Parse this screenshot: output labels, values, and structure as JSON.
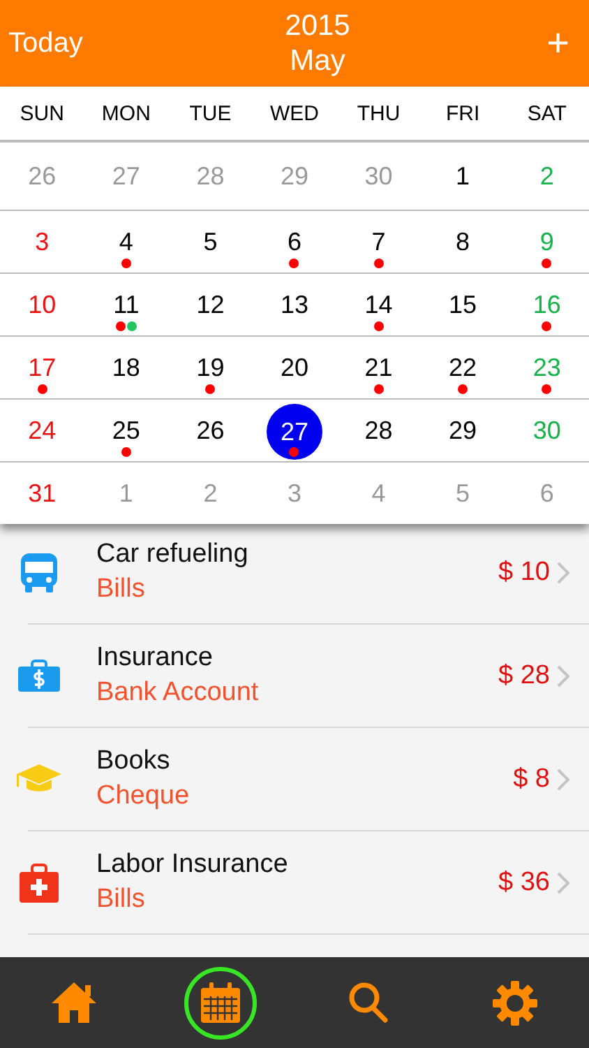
{
  "header": {
    "today_button": "Today",
    "year": "2015",
    "month": "May",
    "add_button": "+"
  },
  "weekdays": [
    "SUN",
    "MON",
    "TUE",
    "WED",
    "THU",
    "FRI",
    "SAT"
  ],
  "weeks": [
    [
      {
        "day": "26",
        "kind": "other",
        "selected": false
      },
      {
        "day": "27",
        "kind": "other",
        "selected": false
      },
      {
        "day": "28",
        "kind": "other",
        "selected": false
      },
      {
        "day": "29",
        "kind": "other",
        "selected": false
      },
      {
        "day": "30",
        "kind": "other",
        "selected": false
      },
      {
        "day": "1",
        "kind": "weekday",
        "selected": false
      },
      {
        "day": "2",
        "kind": "saturday",
        "selected": false
      }
    ],
    [
      {
        "day": "3",
        "kind": "sunday",
        "selected": false
      },
      {
        "day": "4",
        "kind": "weekday",
        "selected": false,
        "dots": [
          {
            "color": "#ff0000"
          }
        ]
      },
      {
        "day": "5",
        "kind": "weekday",
        "selected": false
      },
      {
        "day": "6",
        "kind": "weekday",
        "selected": false,
        "dots": [
          {
            "color": "#ff0000"
          }
        ]
      },
      {
        "day": "7",
        "kind": "weekday",
        "selected": false,
        "dots": [
          {
            "color": "#ff0000"
          }
        ]
      },
      {
        "day": "8",
        "kind": "weekday",
        "selected": false
      },
      {
        "day": "9",
        "kind": "saturday",
        "selected": false,
        "dots": [
          {
            "color": "#ff0000"
          }
        ]
      }
    ],
    [
      {
        "day": "10",
        "kind": "sunday",
        "selected": false
      },
      {
        "day": "11",
        "kind": "weekday",
        "selected": false,
        "dots": [
          {
            "color": "#ff0000"
          },
          {
            "color": "#22c55e"
          }
        ]
      },
      {
        "day": "12",
        "kind": "weekday",
        "selected": false
      },
      {
        "day": "13",
        "kind": "weekday",
        "selected": false
      },
      {
        "day": "14",
        "kind": "weekday",
        "selected": false,
        "dots": [
          {
            "color": "#ff0000"
          }
        ]
      },
      {
        "day": "15",
        "kind": "weekday",
        "selected": false
      },
      {
        "day": "16",
        "kind": "saturday",
        "selected": false,
        "dots": [
          {
            "color": "#ff0000"
          }
        ]
      }
    ],
    [
      {
        "day": "17",
        "kind": "sunday",
        "selected": false,
        "dots": [
          {
            "color": "#ff0000"
          }
        ]
      },
      {
        "day": "18",
        "kind": "weekday",
        "selected": false
      },
      {
        "day": "19",
        "kind": "weekday",
        "selected": false,
        "dots": [
          {
            "color": "#ff0000"
          }
        ]
      },
      {
        "day": "20",
        "kind": "weekday",
        "selected": false
      },
      {
        "day": "21",
        "kind": "weekday",
        "selected": false,
        "dots": [
          {
            "color": "#ff0000"
          }
        ]
      },
      {
        "day": "22",
        "kind": "weekday",
        "selected": false,
        "dots": [
          {
            "color": "#ff0000"
          }
        ]
      },
      {
        "day": "23",
        "kind": "saturday",
        "selected": false,
        "dots": [
          {
            "color": "#ff0000"
          }
        ]
      }
    ],
    [
      {
        "day": "24",
        "kind": "sunday",
        "selected": false
      },
      {
        "day": "25",
        "kind": "weekday",
        "selected": false,
        "dots": [
          {
            "color": "#ff0000"
          }
        ]
      },
      {
        "day": "26",
        "kind": "weekday",
        "selected": false
      },
      {
        "day": "27",
        "kind": "weekday",
        "selected": true,
        "dots": [
          {
            "color": "#ff0000"
          }
        ]
      },
      {
        "day": "28",
        "kind": "weekday",
        "selected": false
      },
      {
        "day": "29",
        "kind": "weekday",
        "selected": false
      },
      {
        "day": "30",
        "kind": "saturday",
        "selected": false
      }
    ],
    [
      {
        "day": "31",
        "kind": "sunday",
        "selected": false
      },
      {
        "day": "1",
        "kind": "other",
        "selected": false
      },
      {
        "day": "2",
        "kind": "other",
        "selected": false
      },
      {
        "day": "3",
        "kind": "other",
        "selected": false
      },
      {
        "day": "4",
        "kind": "other",
        "selected": false
      },
      {
        "day": "5",
        "kind": "other",
        "selected": false
      },
      {
        "day": "6",
        "kind": "other",
        "selected": false
      }
    ]
  ],
  "entries": [
    {
      "kind": "bus",
      "title": "Car refueling",
      "account": "Bills",
      "amount": "$ 10"
    },
    {
      "kind": "briefcase",
      "title": "Insurance",
      "account": "Bank Account",
      "amount": "$ 28"
    },
    {
      "kind": "cap",
      "title": "Books",
      "account": "Cheque",
      "amount": "$ 8"
    },
    {
      "kind": "medkit",
      "title": "Labor Insurance",
      "account": "Bills",
      "amount": "$ 36"
    }
  ],
  "tab_bar": [
    {
      "kind": "home",
      "selected": false
    },
    {
      "kind": "calendar",
      "selected": true
    },
    {
      "kind": "search",
      "selected": false
    },
    {
      "kind": "settings",
      "selected": false
    }
  ]
}
